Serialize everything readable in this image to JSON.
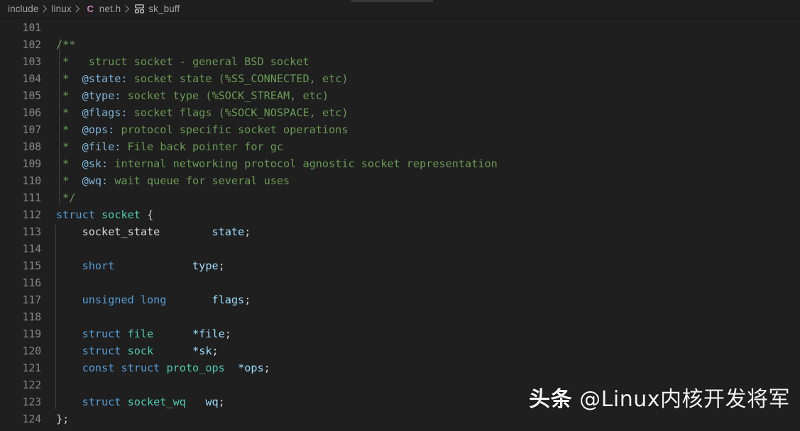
{
  "breadcrumb": {
    "items": [
      {
        "label": "include",
        "icon": null
      },
      {
        "label": "linux",
        "icon": null
      },
      {
        "label": "net.h",
        "icon": "c-file-icon"
      },
      {
        "label": "sk_buff",
        "icon": "symbol-structure-icon"
      }
    ],
    "separator": "›"
  },
  "editor": {
    "language": "c",
    "first_line_number": 101,
    "last_line_number": 124,
    "lines": [
      {
        "num": "101",
        "tokens": []
      },
      {
        "num": "102",
        "tokens": [
          {
            "t": "/**",
            "c": "cmt"
          }
        ]
      },
      {
        "num": "103",
        "tokens": [
          {
            "t": " *   struct socket - general BSD socket",
            "c": "cmt"
          }
        ]
      },
      {
        "num": "104",
        "tokens": [
          {
            "t": " *  ",
            "c": "cmt"
          },
          {
            "t": "@state:",
            "c": "cmtkw"
          },
          {
            "t": " socket state (%SS_CONNECTED, etc)",
            "c": "cmt"
          }
        ]
      },
      {
        "num": "105",
        "tokens": [
          {
            "t": " *  ",
            "c": "cmt"
          },
          {
            "t": "@type:",
            "c": "cmtkw"
          },
          {
            "t": " socket type (%SOCK_STREAM, etc)",
            "c": "cmt"
          }
        ]
      },
      {
        "num": "106",
        "tokens": [
          {
            "t": " *  ",
            "c": "cmt"
          },
          {
            "t": "@flags:",
            "c": "cmtkw"
          },
          {
            "t": " socket flags (%SOCK_NOSPACE, etc)",
            "c": "cmt"
          }
        ]
      },
      {
        "num": "107",
        "tokens": [
          {
            "t": " *  ",
            "c": "cmt"
          },
          {
            "t": "@ops:",
            "c": "cmtkw"
          },
          {
            "t": " protocol specific socket operations",
            "c": "cmt"
          }
        ]
      },
      {
        "num": "108",
        "tokens": [
          {
            "t": " *  ",
            "c": "cmt"
          },
          {
            "t": "@file:",
            "c": "cmtkw"
          },
          {
            "t": " File back pointer for gc",
            "c": "cmt"
          }
        ]
      },
      {
        "num": "109",
        "tokens": [
          {
            "t": " *  ",
            "c": "cmt"
          },
          {
            "t": "@sk:",
            "c": "cmtkw"
          },
          {
            "t": " internal networking protocol agnostic socket representation",
            "c": "cmt"
          }
        ]
      },
      {
        "num": "110",
        "tokens": [
          {
            "t": " *  ",
            "c": "cmt"
          },
          {
            "t": "@wq:",
            "c": "cmtkw"
          },
          {
            "t": " wait queue for several uses",
            "c": "cmt"
          }
        ]
      },
      {
        "num": "111",
        "tokens": [
          {
            "t": " */",
            "c": "cmt"
          }
        ]
      },
      {
        "num": "112",
        "tokens": [
          {
            "t": "struct",
            "c": "kw"
          },
          {
            "t": " ",
            "c": "plain"
          },
          {
            "t": "socket",
            "c": "type"
          },
          {
            "t": " {",
            "c": "punc"
          }
        ]
      },
      {
        "num": "113",
        "tokens": [
          {
            "t": "    ",
            "c": "plain"
          },
          {
            "t": "socket_state",
            "c": "plain"
          },
          {
            "t": "        ",
            "c": "plain"
          },
          {
            "t": "state",
            "c": "var"
          },
          {
            "t": ";",
            "c": "punc"
          }
        ]
      },
      {
        "num": "114",
        "tokens": []
      },
      {
        "num": "115",
        "tokens": [
          {
            "t": "    ",
            "c": "plain"
          },
          {
            "t": "short",
            "c": "kw"
          },
          {
            "t": "            ",
            "c": "plain"
          },
          {
            "t": "type",
            "c": "var"
          },
          {
            "t": ";",
            "c": "punc"
          }
        ]
      },
      {
        "num": "116",
        "tokens": []
      },
      {
        "num": "117",
        "tokens": [
          {
            "t": "    ",
            "c": "plain"
          },
          {
            "t": "unsigned long",
            "c": "kw"
          },
          {
            "t": "       ",
            "c": "plain"
          },
          {
            "t": "flags",
            "c": "var"
          },
          {
            "t": ";",
            "c": "punc"
          }
        ]
      },
      {
        "num": "118",
        "tokens": []
      },
      {
        "num": "119",
        "tokens": [
          {
            "t": "    ",
            "c": "plain"
          },
          {
            "t": "struct",
            "c": "kw"
          },
          {
            "t": " ",
            "c": "plain"
          },
          {
            "t": "file",
            "c": "type"
          },
          {
            "t": "      ",
            "c": "plain"
          },
          {
            "t": "*file",
            "c": "var"
          },
          {
            "t": ";",
            "c": "punc"
          }
        ]
      },
      {
        "num": "120",
        "tokens": [
          {
            "t": "    ",
            "c": "plain"
          },
          {
            "t": "struct",
            "c": "kw"
          },
          {
            "t": " ",
            "c": "plain"
          },
          {
            "t": "sock",
            "c": "type"
          },
          {
            "t": "      ",
            "c": "plain"
          },
          {
            "t": "*sk",
            "c": "var"
          },
          {
            "t": ";",
            "c": "punc"
          }
        ]
      },
      {
        "num": "121",
        "tokens": [
          {
            "t": "    ",
            "c": "plain"
          },
          {
            "t": "const",
            "c": "kw"
          },
          {
            "t": " ",
            "c": "plain"
          },
          {
            "t": "struct",
            "c": "kw"
          },
          {
            "t": " ",
            "c": "plain"
          },
          {
            "t": "proto_ops",
            "c": "type"
          },
          {
            "t": "  ",
            "c": "plain"
          },
          {
            "t": "*ops",
            "c": "var"
          },
          {
            "t": ";",
            "c": "punc"
          }
        ]
      },
      {
        "num": "122",
        "tokens": []
      },
      {
        "num": "123",
        "tokens": [
          {
            "t": "    ",
            "c": "plain"
          },
          {
            "t": "struct",
            "c": "kw"
          },
          {
            "t": " ",
            "c": "plain"
          },
          {
            "t": "socket_wq",
            "c": "type"
          },
          {
            "t": "   ",
            "c": "plain"
          },
          {
            "t": "wq",
            "c": "var"
          },
          {
            "t": ";",
            "c": "punc"
          }
        ]
      },
      {
        "num": "124",
        "tokens": [
          {
            "t": "};",
            "c": "punc"
          }
        ]
      }
    ],
    "guides": [
      {
        "x": 83,
        "top_line": 102,
        "bottom_line": 111
      },
      {
        "x": 78,
        "top_line": 113,
        "bottom_line": 123
      }
    ]
  },
  "watermark": {
    "brand": "头条",
    "handle": " @Linux内核开发将军"
  },
  "colors": {
    "background": "#1f1f1f",
    "line_number": "#858585",
    "comment": "#6a9955",
    "comment_tag": "#7fb2d8",
    "keyword": "#569cd6",
    "type": "#4ec9b0",
    "variable": "#9cdcfe",
    "punctuation": "#cccccc",
    "breadcrumb_text": "#a2a2a2",
    "c_icon": "#c586c0"
  }
}
